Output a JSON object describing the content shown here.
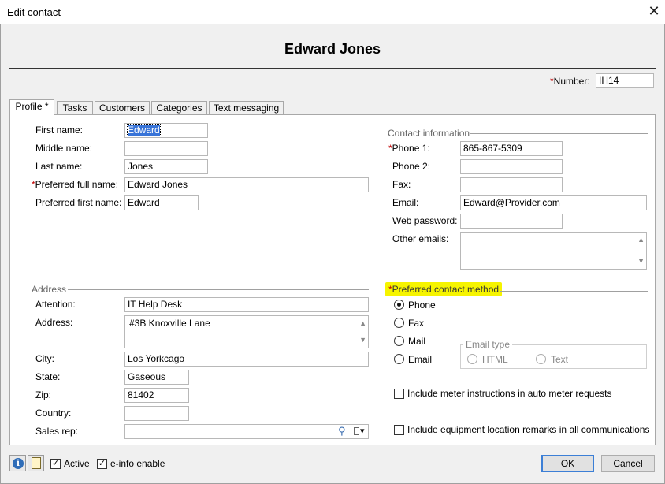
{
  "window": {
    "title": "Edit contact",
    "close_glyph": "✕"
  },
  "contact_heading": "Edward Jones",
  "number": {
    "required_mark": "*",
    "label": "Number:",
    "value": "IH14"
  },
  "tabs": [
    {
      "label": "Profile *",
      "active": true
    },
    {
      "label": "Tasks",
      "active": false
    },
    {
      "label": "Customers",
      "active": false
    },
    {
      "label": "Categories",
      "active": false
    },
    {
      "label": "Text messaging",
      "active": false
    }
  ],
  "profile": {
    "first_name": {
      "label": "First name:",
      "value": "Edward"
    },
    "middle_name": {
      "label": "Middle name:",
      "value": ""
    },
    "last_name": {
      "label": "Last name:",
      "value": "Jones"
    },
    "preferred_full_name": {
      "required_mark": "*",
      "label": "Preferred full name:",
      "value": "Edward Jones"
    },
    "preferred_first_name": {
      "label": "Preferred first name:",
      "value": "Edward"
    }
  },
  "contact_info": {
    "group_title": "Contact information",
    "phone1": {
      "required_mark": "*",
      "label": "Phone 1:",
      "value": "865-867-5309"
    },
    "phone2": {
      "label": "Phone 2:",
      "value": ""
    },
    "fax": {
      "label": "Fax:",
      "value": ""
    },
    "email": {
      "label": "Email:",
      "value": "Edward@Provider.com"
    },
    "web_password": {
      "label": "Web password:",
      "value": ""
    },
    "other_emails": {
      "label": "Other emails:",
      "value": ""
    }
  },
  "address": {
    "group_title": "Address",
    "attention": {
      "label": "Attention:",
      "value": "IT Help Desk"
    },
    "address": {
      "label": "Address:",
      "value": "#3B Knoxville Lane"
    },
    "city": {
      "label": "City:",
      "value": "Los Yorkcago"
    },
    "state": {
      "label": "State:",
      "value": "Gaseous"
    },
    "zip": {
      "label": "Zip:",
      "value": "81402"
    },
    "country": {
      "label": "Country:",
      "value": ""
    },
    "sales_rep": {
      "label": "Sales rep:",
      "value": ""
    }
  },
  "preferred_contact": {
    "required_mark": "*",
    "group_title": "Preferred contact method",
    "options": [
      {
        "label": "Phone",
        "selected": true
      },
      {
        "label": "Fax",
        "selected": false
      },
      {
        "label": "Mail",
        "selected": false
      },
      {
        "label": "Email",
        "selected": false
      }
    ],
    "email_type": {
      "group_title": "Email type",
      "options": [
        {
          "label": "HTML"
        },
        {
          "label": "Text"
        }
      ]
    }
  },
  "options": {
    "meter_instructions": {
      "label": "Include meter instructions in auto meter requests",
      "checked": false
    },
    "equipment_remarks": {
      "label": "Include equipment location remarks in all communications",
      "checked": false
    }
  },
  "footer": {
    "active": {
      "label": "Active",
      "checked": true
    },
    "einfo": {
      "label": "e-info enable",
      "checked": true
    },
    "ok_label": "OK",
    "cancel_label": "Cancel"
  },
  "icons": {
    "info_glyph": "i",
    "check_glyph": "✓",
    "search_glyph": "⚲",
    "scroll_up_glyph": "▲",
    "scroll_down_glyph": "▼",
    "dropdown_glyph": "▾"
  },
  "colors": {
    "highlight": "#f6f400",
    "required": "#c00000",
    "selection": "#3874d8",
    "ok_border": "#3c7fd6"
  }
}
